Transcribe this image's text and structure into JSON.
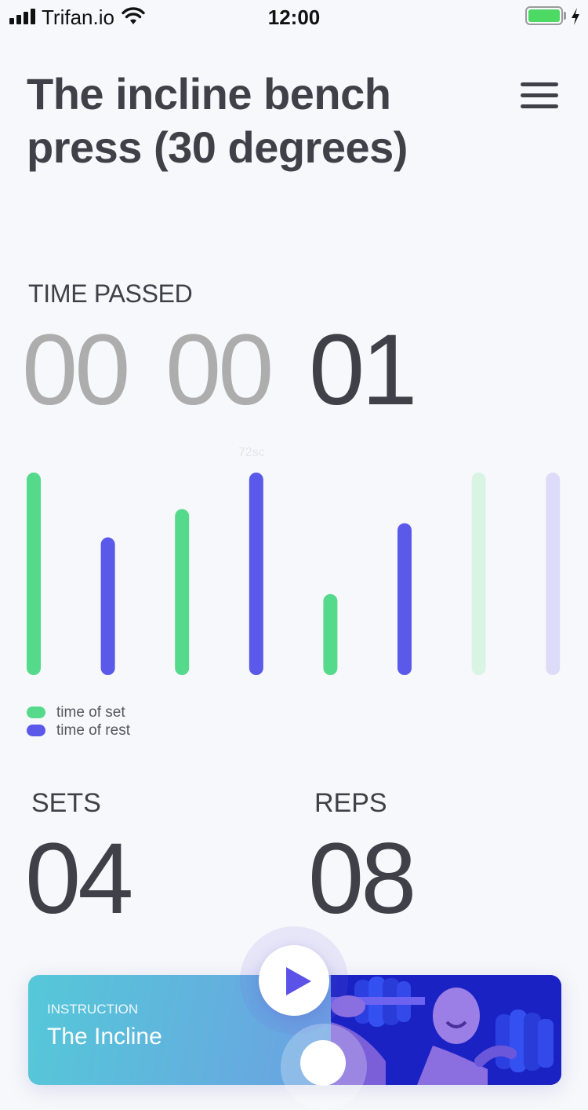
{
  "status_bar": {
    "carrier": "Trifan.io",
    "time": "12:00",
    "battery_level": 1.0,
    "battery_color": "#4cd964"
  },
  "header": {
    "title": "The incline bench press (30 degrees)",
    "menu_icon": "hamburger-menu-icon"
  },
  "timer": {
    "label": "TIME PASSED",
    "hours": "00",
    "minutes": "00",
    "seconds": "01"
  },
  "chart_data": {
    "type": "bar",
    "annotation": "72sc",
    "ylim": [
      0,
      1
    ],
    "bars": [
      {
        "series": "time of set",
        "value": 1.0,
        "faded": false
      },
      {
        "series": "time of rest",
        "value": 0.68,
        "faded": false
      },
      {
        "series": "time of set",
        "value": 0.82,
        "faded": false
      },
      {
        "series": "time of rest",
        "value": 1.0,
        "faded": false
      },
      {
        "series": "time of set",
        "value": 0.4,
        "faded": false
      },
      {
        "series": "time of rest",
        "value": 0.75,
        "faded": false
      },
      {
        "series": "time of set",
        "value": 1.0,
        "faded": true
      },
      {
        "series": "time of rest",
        "value": 1.0,
        "faded": true
      }
    ],
    "series": [
      {
        "name": "time of set",
        "color": "#55d98b",
        "faded_color": "#d9f4e3"
      },
      {
        "name": "time of rest",
        "color": "#5b59e9",
        "faded_color": "#dcdcf8"
      }
    ]
  },
  "legend": {
    "items": [
      {
        "label": "time of set",
        "color": "#55d98b"
      },
      {
        "label": "time of rest",
        "color": "#5b59e9"
      }
    ]
  },
  "stats": {
    "sets_label": "SETS",
    "sets_value": "04",
    "reps_label": "REPS",
    "reps_value": "08"
  },
  "card": {
    "kicker": "INSTRUCTION",
    "title": "The Incline"
  }
}
